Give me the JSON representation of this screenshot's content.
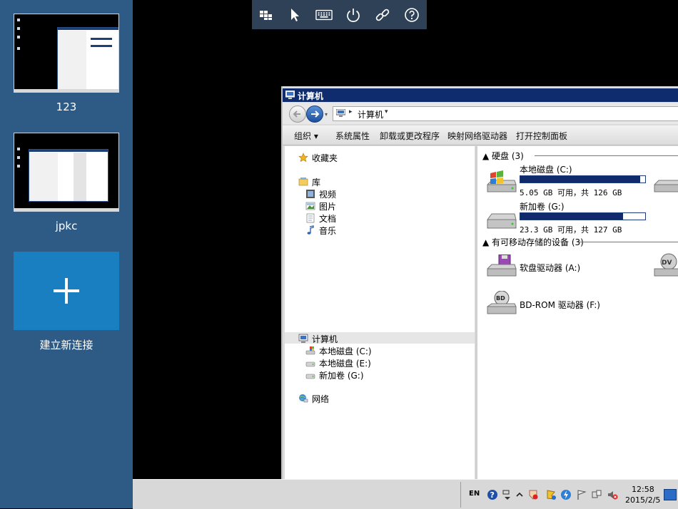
{
  "sessions": [
    {
      "label": "123"
    },
    {
      "label": "jpkc"
    }
  ],
  "new_connection": {
    "label": "建立新连接"
  },
  "remote_toolbar": {
    "buttons": [
      "windows-flag-icon",
      "pointer-icon",
      "keyboard-icon",
      "power-icon",
      "link-icon",
      "help-icon"
    ]
  },
  "explorer": {
    "title": "计算机",
    "address": {
      "path": "计算机",
      "separator": "▸",
      "dropdown": "▾"
    },
    "nav_dropdown": "▾",
    "commands": {
      "organize": "组织 ▾",
      "system_properties": "系统属性",
      "uninstall": "卸载或更改程序",
      "map_drive": "映射网络驱动器",
      "control_panel": "打开控制面板"
    },
    "nav": {
      "favorites": "收藏夹",
      "libraries": "库",
      "videos": "视频",
      "pictures": "图片",
      "documents": "文档",
      "music": "音乐",
      "computer": "计算机",
      "local_c": "本地磁盘 (C:)",
      "local_e": "本地磁盘 (E:)",
      "new_volume_g": "新加卷 (G:)",
      "network": "网络"
    },
    "groups": {
      "hard_disks": "▲ 硬盘 (3)",
      "removable": "▲ 有可移动存储的设备 (3)"
    },
    "drives": [
      {
        "name": "本地磁盘 (C:)",
        "free": "5.05 GB 可用，共 126 GB",
        "used_fraction": 0.96
      },
      {
        "name": "新加卷 (G:)",
        "free": "23.3 GB 可用，共 127 GB",
        "used_fraction": 0.82
      }
    ],
    "removable": [
      {
        "name": "软盘驱动器 (A:)"
      },
      {
        "name": "BD-ROM 驱动器 (F:)"
      }
    ]
  },
  "taskbar": {
    "lang": "EN",
    "time": "12:58",
    "date": "2015/2/5"
  },
  "colors": {
    "sidebar": "#2e5a86",
    "new_tile": "#1a7fc1",
    "titlebar": "#0f2c6e",
    "capacity_fill": "#112a6b"
  }
}
